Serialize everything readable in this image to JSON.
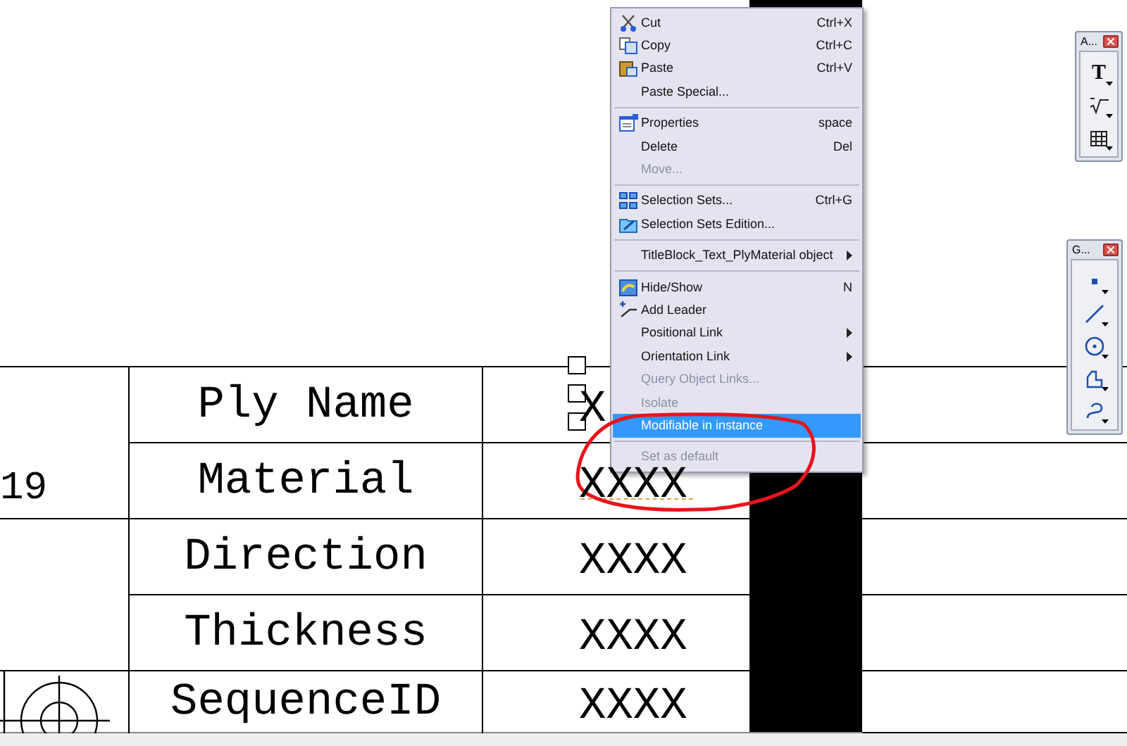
{
  "table": {
    "left_column": {
      "number": "19"
    },
    "rows": [
      {
        "label": "Ply Name",
        "value": "X"
      },
      {
        "label": "Material",
        "value": "XXXX"
      },
      {
        "label": "Direction",
        "value": "XXXX"
      },
      {
        "label": "Thickness",
        "value": "XXXX"
      },
      {
        "label": "SequenceID",
        "value": "XXXX"
      }
    ]
  },
  "context_menu": {
    "items": [
      {
        "kind": "item",
        "label": "Cut",
        "shortcut": "Ctrl+X",
        "disabled": false,
        "selected": false,
        "submenu": false
      },
      {
        "kind": "item",
        "label": "Copy",
        "shortcut": "Ctrl+C",
        "disabled": false,
        "selected": false,
        "submenu": false
      },
      {
        "kind": "item",
        "label": "Paste",
        "shortcut": "Ctrl+V",
        "disabled": false,
        "selected": false,
        "submenu": false
      },
      {
        "kind": "item",
        "label": "Paste Special...",
        "disabled": false,
        "selected": false,
        "submenu": false
      },
      {
        "kind": "separator"
      },
      {
        "kind": "item",
        "label": "Properties",
        "shortcut": "space",
        "disabled": false,
        "selected": false,
        "submenu": false
      },
      {
        "kind": "item",
        "label": "Delete",
        "shortcut": "Del",
        "disabled": false,
        "selected": false,
        "submenu": false
      },
      {
        "kind": "item",
        "label": "Move...",
        "disabled": true,
        "selected": false,
        "submenu": false
      },
      {
        "kind": "separator"
      },
      {
        "kind": "item",
        "label": "Selection Sets...",
        "shortcut": "Ctrl+G",
        "disabled": false,
        "selected": false,
        "submenu": false
      },
      {
        "kind": "item",
        "label": "Selection Sets Edition...",
        "disabled": false,
        "selected": false,
        "submenu": false
      },
      {
        "kind": "separator"
      },
      {
        "kind": "item",
        "label": "TitleBlock_Text_PlyMaterial object",
        "disabled": false,
        "selected": false,
        "submenu": true
      },
      {
        "kind": "separator"
      },
      {
        "kind": "item",
        "label": "Hide/Show",
        "shortcut": "N",
        "disabled": false,
        "selected": false,
        "submenu": false
      },
      {
        "kind": "item",
        "label": "Add Leader",
        "disabled": false,
        "selected": false,
        "submenu": false
      },
      {
        "kind": "item",
        "label": "Positional Link",
        "disabled": false,
        "selected": false,
        "submenu": true
      },
      {
        "kind": "item",
        "label": "Orientation Link",
        "disabled": false,
        "selected": false,
        "submenu": true
      },
      {
        "kind": "item",
        "label": "Query Object Links...",
        "disabled": true,
        "selected": false,
        "submenu": false
      },
      {
        "kind": "item",
        "label": "Isolate",
        "disabled": true,
        "selected": false,
        "submenu": false
      },
      {
        "kind": "item",
        "label": "Modifiable in instance",
        "disabled": false,
        "selected": true,
        "submenu": false
      },
      {
        "kind": "separator"
      },
      {
        "kind": "item",
        "label": "Set as default",
        "disabled": true,
        "selected": false,
        "submenu": false
      }
    ]
  },
  "toolbars": [
    {
      "title": "A...",
      "tool_label": "T"
    },
    {
      "title": "G..."
    }
  ]
}
